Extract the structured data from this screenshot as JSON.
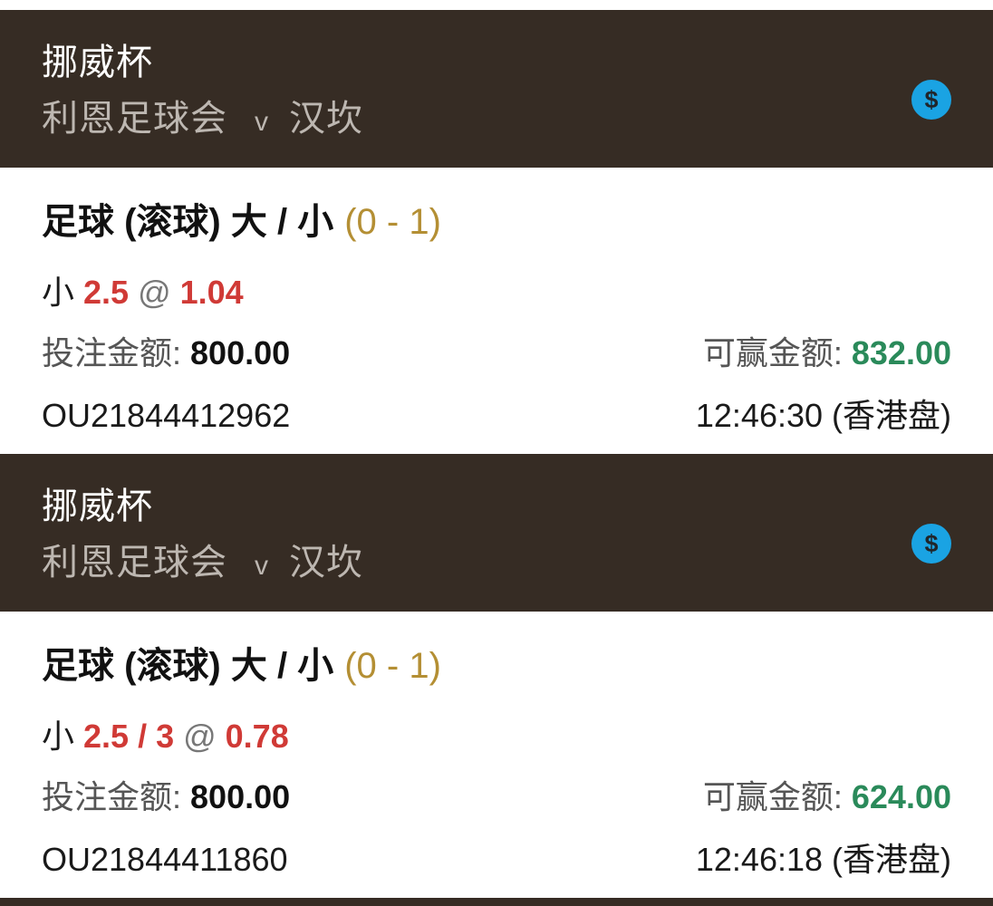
{
  "bets": [
    {
      "league": "挪威杯",
      "home_team": "利恩足球会",
      "vs": "v",
      "away_team": "汉坎",
      "icon": "dollar-icon",
      "market": "足球 (滚球) 大 / 小",
      "score": "(0 - 1)",
      "selection_side": "小",
      "handicap": "2.5",
      "at": "@",
      "odds": "1.04",
      "stake_label": "投注金额:",
      "stake": "800.00",
      "win_label": "可赢金额:",
      "win": "832.00",
      "ref": "OU21844412962",
      "time": "12:46:30 (香港盘)"
    },
    {
      "league": "挪威杯",
      "home_team": "利恩足球会",
      "vs": "v",
      "away_team": "汉坎",
      "icon": "dollar-icon",
      "market": "足球 (滚球) 大 / 小",
      "score": "(0 - 1)",
      "selection_side": "小",
      "handicap": "2.5 / 3",
      "at": "@",
      "odds": "0.78",
      "stake_label": "投注金额:",
      "stake": "800.00",
      "win_label": "可赢金额:",
      "win": "624.00",
      "ref": "OU21844411860",
      "time": "12:46:18 (香港盘)"
    }
  ],
  "colors": {
    "header_bg": "#362c24",
    "icon": "#1aa3e3",
    "odds_red": "#d03a36",
    "win_green": "#2a8a5a",
    "score_gold": "#b48f34"
  }
}
